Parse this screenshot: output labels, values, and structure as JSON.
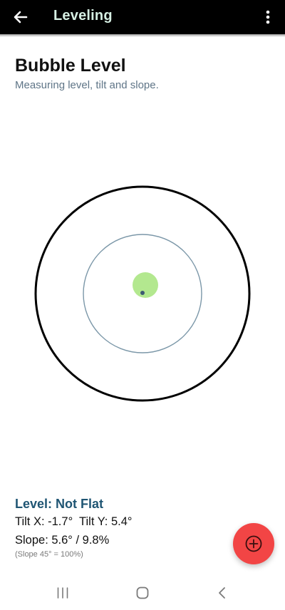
{
  "app_bar": {
    "title": "Leveling",
    "back_icon": "arrow-left-icon",
    "menu_icon": "more-vertical-icon"
  },
  "header": {
    "title": "Bubble Level",
    "subtitle": "Measuring level, tilt and slope."
  },
  "level": {
    "bubble_color": "#b3e88f",
    "center_dot_color": "#3d5a73",
    "outer_ring_color": "#000000",
    "inner_ring_color": "#7b97a8"
  },
  "readout": {
    "status": "Level: Not Flat",
    "tilt": "Tilt X: -1.7°  Tilt Y: 5.4°",
    "slope": "Slope: 5.6° / 9.8%",
    "slope_note": "(Slope 45° = 100%)"
  },
  "fab": {
    "icon": "add-circle-icon",
    "color": "#f24545"
  },
  "nav_bar": {
    "recents_icon": "recents-icon",
    "home_icon": "home-icon",
    "back_icon": "back-chevron-icon"
  }
}
